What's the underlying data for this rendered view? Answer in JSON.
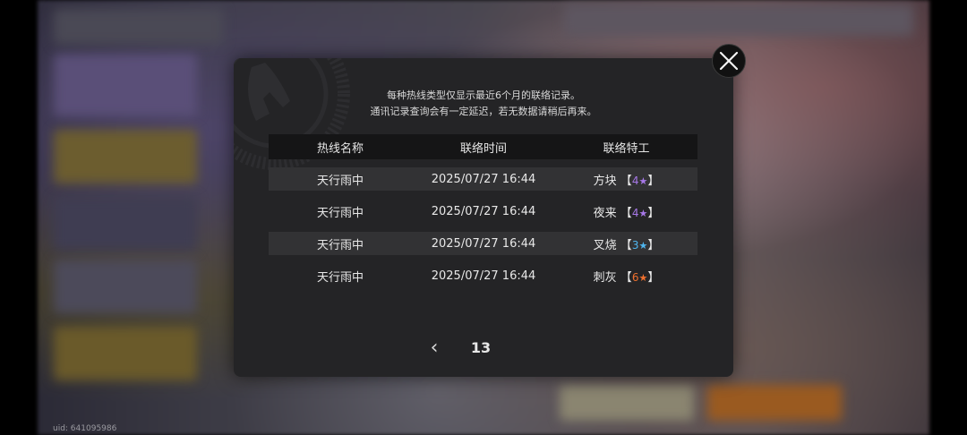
{
  "footer": {
    "uid": "uid: 641095986"
  },
  "notice": {
    "line1": "每种热线类型仅显示最近6个月的联络记录。",
    "line2": "通讯记录查询会有一定延迟，若无数据请稍后再来。"
  },
  "table": {
    "headers": {
      "name": "热线名称",
      "time": "联络时间",
      "agent": "联络特工"
    },
    "rows": [
      {
        "name": "天行雨中",
        "time": "2025/07/27 16:44",
        "agent": "方块",
        "rank": "4",
        "star": "★",
        "rank_color": "#a778e8"
      },
      {
        "name": "天行雨中",
        "time": "2025/07/27 16:44",
        "agent": "夜来",
        "rank": "4",
        "star": "★",
        "rank_color": "#a778e8"
      },
      {
        "name": "天行雨中",
        "time": "2025/07/27 16:44",
        "agent": "叉烧",
        "rank": "3",
        "star": "★",
        "rank_color": "#4fb6f0"
      },
      {
        "name": "天行雨中",
        "time": "2025/07/27 16:44",
        "agent": "刺灰",
        "rank": "6",
        "star": "★",
        "rank_color": "#f0702e"
      }
    ]
  },
  "pager": {
    "prev_icon": "chevron-left-icon",
    "prev_glyph": "‹",
    "page": "13"
  },
  "close": {
    "icon": "close-icon"
  },
  "colors": {
    "modal_bg": "#242426",
    "header_bg": "#151516",
    "row_stripe": "#323234"
  }
}
